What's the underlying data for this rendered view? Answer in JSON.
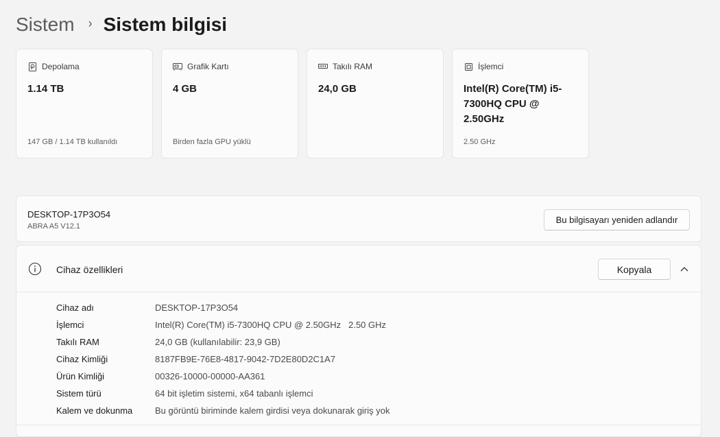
{
  "breadcrumb": {
    "parent": "Sistem",
    "separator": "›",
    "current": "Sistem bilgisi"
  },
  "cards": [
    {
      "icon": "storage-icon",
      "title": "Depolama",
      "value": "1.14 TB",
      "sub": "147 GB / 1.14 TB kullanıldı"
    },
    {
      "icon": "graphics-card-icon",
      "title": "Grafik Kartı",
      "value": "4 GB",
      "sub": "Birden fazla GPU yüklü"
    },
    {
      "icon": "ram-icon",
      "title": "Takılı RAM",
      "value": "24,0 GB",
      "sub": ""
    },
    {
      "icon": "processor-icon",
      "title": "İşlemci",
      "value": "Intel(R) Core(TM) i5-7300HQ CPU @ 2.50GHz",
      "sub": "2.50 GHz"
    }
  ],
  "device": {
    "name": "DESKTOP-17P3O54",
    "model": "ABRA A5 V12.1",
    "rename_label": "Bu bilgisayarı yeniden adlandır"
  },
  "specs": {
    "title": "Cihaz özellikleri",
    "copy_label": "Kopyala",
    "rows": [
      {
        "label": "Cihaz adı",
        "value": "DESKTOP-17P3O54",
        "extra": ""
      },
      {
        "label": "İşlemci",
        "value": "Intel(R) Core(TM) i5-7300HQ CPU @ 2.50GHz",
        "extra": "2.50 GHz"
      },
      {
        "label": "Takılı RAM",
        "value": "24,0 GB (kullanılabilir: 23,9 GB)",
        "extra": ""
      },
      {
        "label": "Cihaz Kimliği",
        "value": "8187FB9E-76E8-4817-9042-7D2E80D2C1A7",
        "extra": ""
      },
      {
        "label": "Ürün Kimliği",
        "value": "00326-10000-00000-AA361",
        "extra": ""
      },
      {
        "label": "Sistem türü",
        "value": "64 bit işletim sistemi, x64 tabanlı işlemci",
        "extra": ""
      },
      {
        "label": "Kalem ve dokunma",
        "value": "Bu görüntü biriminde kalem girdisi veya dokunarak giriş yok",
        "extra": ""
      }
    ]
  }
}
